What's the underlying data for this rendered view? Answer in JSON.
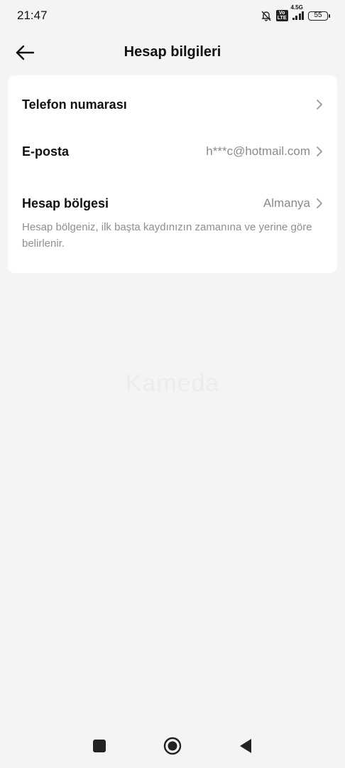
{
  "status_bar": {
    "time": "21:47",
    "volte": "Vo LTE",
    "network": "4.5G",
    "battery": "55"
  },
  "header": {
    "title": "Hesap bilgileri"
  },
  "rows": {
    "phone": {
      "label": "Telefon numarası"
    },
    "email": {
      "label": "E-posta",
      "value": "h***c@hotmail.com"
    },
    "region": {
      "label": "Hesap bölgesi",
      "value": "Almanya",
      "description": "Hesap bölgeniz, ilk başta kaydınızın zamanına ve yerine göre belirlenir."
    }
  },
  "watermark": "Kameda",
  "icons": {
    "back": "arrow-left-icon",
    "chevron": "chevron-right-icon",
    "mute": "bell-off-icon",
    "nav_recent": "square-icon",
    "nav_home": "circle-icon",
    "nav_back": "triangle-icon"
  }
}
